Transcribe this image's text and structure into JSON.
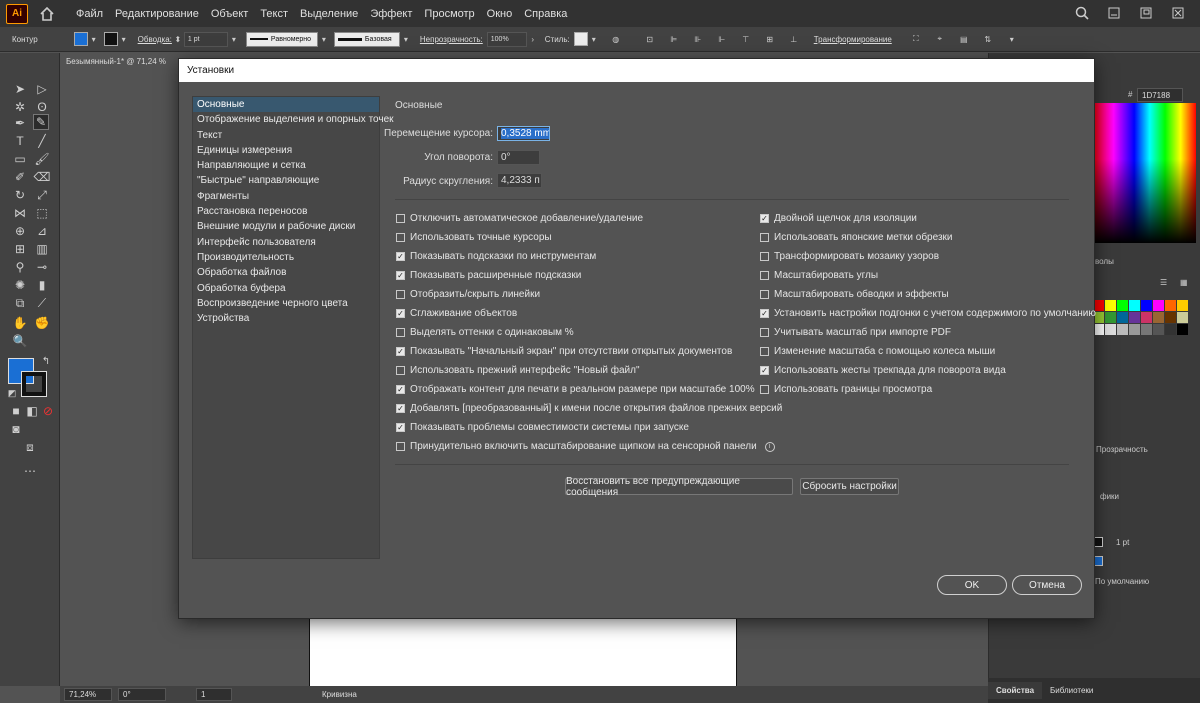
{
  "app": {
    "logo": "Ai"
  },
  "menu": [
    "Файл",
    "Редактирование",
    "Объект",
    "Текст",
    "Выделение",
    "Эффект",
    "Просмотр",
    "Окно",
    "Справка"
  ],
  "control_bar": {
    "mode": "Контур",
    "stroke_label": "Обводка:",
    "stroke_value": "1 pt",
    "profile": "Равномерно",
    "brush": "Базовая",
    "opacity_label": "Непрозрачность:",
    "opacity_value": "100%",
    "style_label": "Стиль:",
    "transform": "Трансформирование"
  },
  "document_tab": "Безымянный-1* @ 71,24 %",
  "colors": {
    "fill": "#1a6fd4",
    "accent": "#38586f"
  },
  "right_panel": {
    "hex": "1D7188",
    "swatches_partial": "волы",
    "transparency": "Прозрачность",
    "graphics_partial": "фики",
    "stroke_value": "1 pt",
    "default_label": "По умолчанию",
    "tabs": [
      "Свойства",
      "Библиотеки"
    ]
  },
  "status": {
    "zoom": "71,24%",
    "angle": "0°",
    "page": "1",
    "tool": "Кривизна"
  },
  "dialog": {
    "title": "Установки",
    "categories": [
      "Основные",
      "Отображение выделения и опорных точек",
      "Текст",
      "Единицы измерения",
      "Направляющие и сетка",
      "\"Быстрые\" направляющие",
      "Фрагменты",
      "Расстановка переносов",
      "Внешние модули и рабочие диски",
      "Интерфейс пользователя",
      "Производительность",
      "Обработка файлов",
      "Обработка буфера",
      "Воспроизведение черного цвета",
      "Устройства"
    ],
    "section_title": "Основные",
    "fields": {
      "cursor_label": "Перемещение курсора:",
      "cursor_value": "0,3528 mm",
      "angle_label": "Угол поворота:",
      "angle_value": "0°",
      "radius_label": "Радиус скругления:",
      "radius_value": "4,2333 п"
    },
    "left_checks": [
      {
        "label": "Отключить автоматическое добавление/удаление",
        "checked": false
      },
      {
        "label": "Использовать точные курсоры",
        "checked": false
      },
      {
        "label": "Показывать подсказки по инструментам",
        "checked": true
      },
      {
        "label": "Показывать расширенные подсказки",
        "checked": true
      },
      {
        "label": "Отобразить/скрыть линейки",
        "checked": false
      },
      {
        "label": "Сглаживание объектов",
        "checked": true
      },
      {
        "label": "Выделять оттенки с одинаковым %",
        "checked": false
      },
      {
        "label": "Показывать \"Начальный экран\" при отсутствии открытых документов",
        "checked": true
      },
      {
        "label": "Использовать прежний интерфейс \"Новый файл\"",
        "checked": false
      },
      {
        "label": "Отображать контент для печати в реальном размере при масштабе 100%",
        "checked": true
      },
      {
        "label": "Добавлять [преобразованный] к имени после открытия файлов прежних версий",
        "checked": true
      },
      {
        "label": "Показывать проблемы совместимости системы при запуске",
        "checked": true
      },
      {
        "label": "Принудительно включить масштабирование щипком на сенсорной панели",
        "checked": false
      }
    ],
    "right_checks": [
      {
        "label": "Двойной щелчок для изоляции",
        "checked": true
      },
      {
        "label": "Использовать японские метки обрезки",
        "checked": false
      },
      {
        "label": "Трансформировать мозаику узоров",
        "checked": false
      },
      {
        "label": "Масштабировать углы",
        "checked": false
      },
      {
        "label": "Масштабировать обводки и эффекты",
        "checked": false
      },
      {
        "label": "Установить настройки подгонки с учетом содержимого по умолчанию",
        "checked": true
      },
      {
        "label": "Учитывать масштаб при импорте PDF",
        "checked": false
      },
      {
        "label": "Изменение масштаба с помощью колеса мыши",
        "checked": false
      },
      {
        "label": "Использовать жесты трекпада для поворота вида",
        "checked": true
      },
      {
        "label": "Использовать границы просмотра",
        "checked": false
      }
    ],
    "buttons": {
      "restore": "Восстановить все предупреждающие сообщения",
      "reset": "Сбросить настройки",
      "ok": "OK",
      "cancel": "Отмена"
    }
  }
}
